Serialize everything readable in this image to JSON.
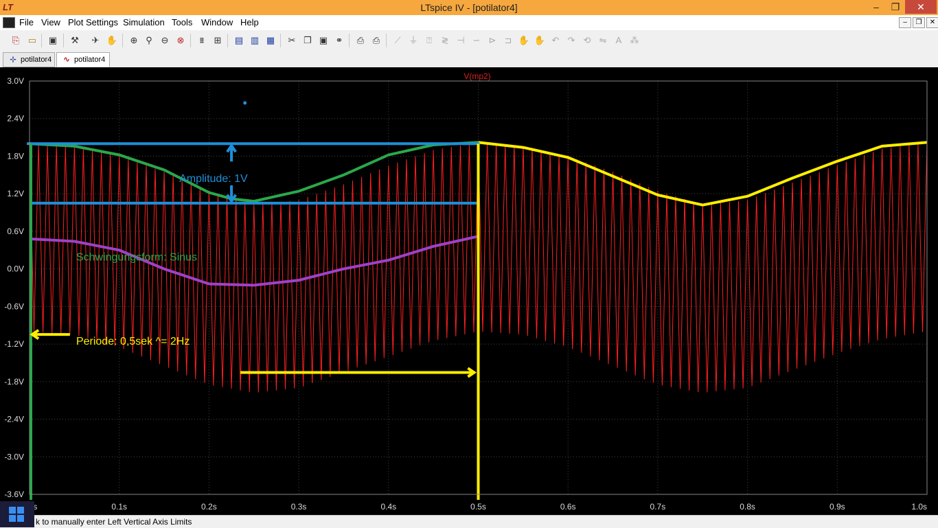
{
  "window": {
    "title": "LTspice IV - [potilator4]",
    "minimize": "–",
    "maximize": "❐",
    "close": "✕"
  },
  "menu": [
    "File",
    "View",
    "Plot Settings",
    "Simulation",
    "Tools",
    "Window",
    "Help"
  ],
  "tabs": [
    {
      "label": "potilator4",
      "icon": "schematic-icon",
      "active": false
    },
    {
      "label": "potilator4",
      "icon": "waveform-icon",
      "active": true
    }
  ],
  "status": {
    "text": "k to manually enter Left Vertical Axis Limits"
  },
  "colors": {
    "background": "#000000",
    "grid": "#444444",
    "trace": "#ff2020",
    "amplitude": "#1e8fd8",
    "waveform_shape": "#2aa84a",
    "period": "#ffee00",
    "midline": "#a040c8",
    "trace_label": "#e02020"
  },
  "chart_data": {
    "type": "line",
    "title": "V(mp2)",
    "xlabel": "",
    "ylabel": "",
    "xlim": [
      0,
      1.0
    ],
    "ylim": [
      -3.6,
      3.0
    ],
    "grid": true,
    "x_ticks": [
      "0.0s",
      "0.1s",
      "0.2s",
      "0.3s",
      "0.4s",
      "0.5s",
      "0.6s",
      "0.7s",
      "0.8s",
      "0.9s",
      "1.0s"
    ],
    "x_tick_values": [
      0,
      0.1,
      0.2,
      0.3,
      0.4,
      0.5,
      0.6,
      0.7,
      0.8,
      0.9,
      1.0
    ],
    "y_ticks": [
      "3.0V",
      "2.4V",
      "1.8V",
      "1.2V",
      "0.6V",
      "0.0V",
      "-0.6V",
      "-1.2V",
      "-1.8V",
      "-2.4V",
      "-3.0V",
      "-3.6V"
    ],
    "y_tick_values": [
      3.0,
      2.4,
      1.8,
      1.2,
      0.6,
      0.0,
      -0.6,
      -1.2,
      -1.8,
      -2.4,
      -3.0,
      -3.6
    ],
    "series": [
      {
        "name": "V(mp2)",
        "carrier_cycles": 100,
        "upper_envelope": {
          "x": [
            0.0,
            0.05,
            0.1,
            0.15,
            0.2,
            0.25,
            0.3,
            0.35,
            0.4,
            0.45,
            0.5,
            0.55,
            0.6,
            0.65,
            0.7,
            0.75,
            0.8,
            0.85,
            0.9,
            0.95,
            1.0
          ],
          "y": [
            2.0,
            1.94,
            1.8,
            1.55,
            1.25,
            1.03,
            1.1,
            1.35,
            1.65,
            1.9,
            2.02,
            1.96,
            1.8,
            1.55,
            1.25,
            1.03,
            1.1,
            1.38,
            1.66,
            1.92,
            2.02
          ]
        },
        "lower_envelope": {
          "x": [
            0.0,
            0.05,
            0.1,
            0.15,
            0.2,
            0.25,
            0.3,
            0.35,
            0.4,
            0.45,
            0.5,
            0.55,
            0.6,
            0.65,
            0.7,
            0.75,
            0.8,
            0.85,
            0.9,
            0.95,
            1.0
          ],
          "y": [
            -1.0,
            -1.05,
            -1.25,
            -1.55,
            -1.85,
            -1.98,
            -1.9,
            -1.65,
            -1.4,
            -1.15,
            -1.0,
            -1.05,
            -1.25,
            -1.55,
            -1.85,
            -1.98,
            -1.9,
            -1.62,
            -1.35,
            -1.12,
            -1.0
          ]
        }
      }
    ],
    "annotations": {
      "amplitude_label": "Amplitude: 1V",
      "waveform_label": "Schwingungsform: Sinus",
      "period_label": "Periode: 0,5sek ^= 2Hz",
      "amplitude_top_v": 2.0,
      "amplitude_bottom_v": 1.05,
      "amplitude_x_range": [
        0.0,
        0.5
      ],
      "amplitude_arrow_x": 0.225,
      "period_left_x": 0.0,
      "period_right_x": 0.5,
      "period_arrow_y": -1.2,
      "period_arrow_right_y": -1.5,
      "period_arrow_right_start_x": 0.235,
      "period_arrow_left_end_x": 0.045,
      "midline": {
        "x": [
          0.0,
          0.05,
          0.1,
          0.15,
          0.2,
          0.25,
          0.3,
          0.35,
          0.4,
          0.45,
          0.5
        ],
        "y": [
          0.48,
          0.44,
          0.3,
          0.0,
          -0.24,
          -0.26,
          -0.18,
          0.0,
          0.14,
          0.36,
          0.52
        ]
      },
      "shape_curve": {
        "x": [
          0.0,
          0.05,
          0.1,
          0.15,
          0.2,
          0.225,
          0.25,
          0.3,
          0.35,
          0.4,
          0.45,
          0.5
        ],
        "y": [
          2.0,
          1.96,
          1.82,
          1.58,
          1.22,
          1.12,
          1.08,
          1.24,
          1.5,
          1.82,
          1.98,
          2.02
        ]
      },
      "period_curve": {
        "x": [
          0.5,
          0.55,
          0.6,
          0.65,
          0.7,
          0.75,
          0.8,
          0.85,
          0.9,
          0.95,
          1.0
        ],
        "y": [
          2.02,
          1.94,
          1.78,
          1.48,
          1.18,
          1.02,
          1.16,
          1.45,
          1.72,
          1.96,
          2.02
        ]
      },
      "stray_dot": {
        "x": 0.24,
        "y": 2.65
      }
    }
  }
}
